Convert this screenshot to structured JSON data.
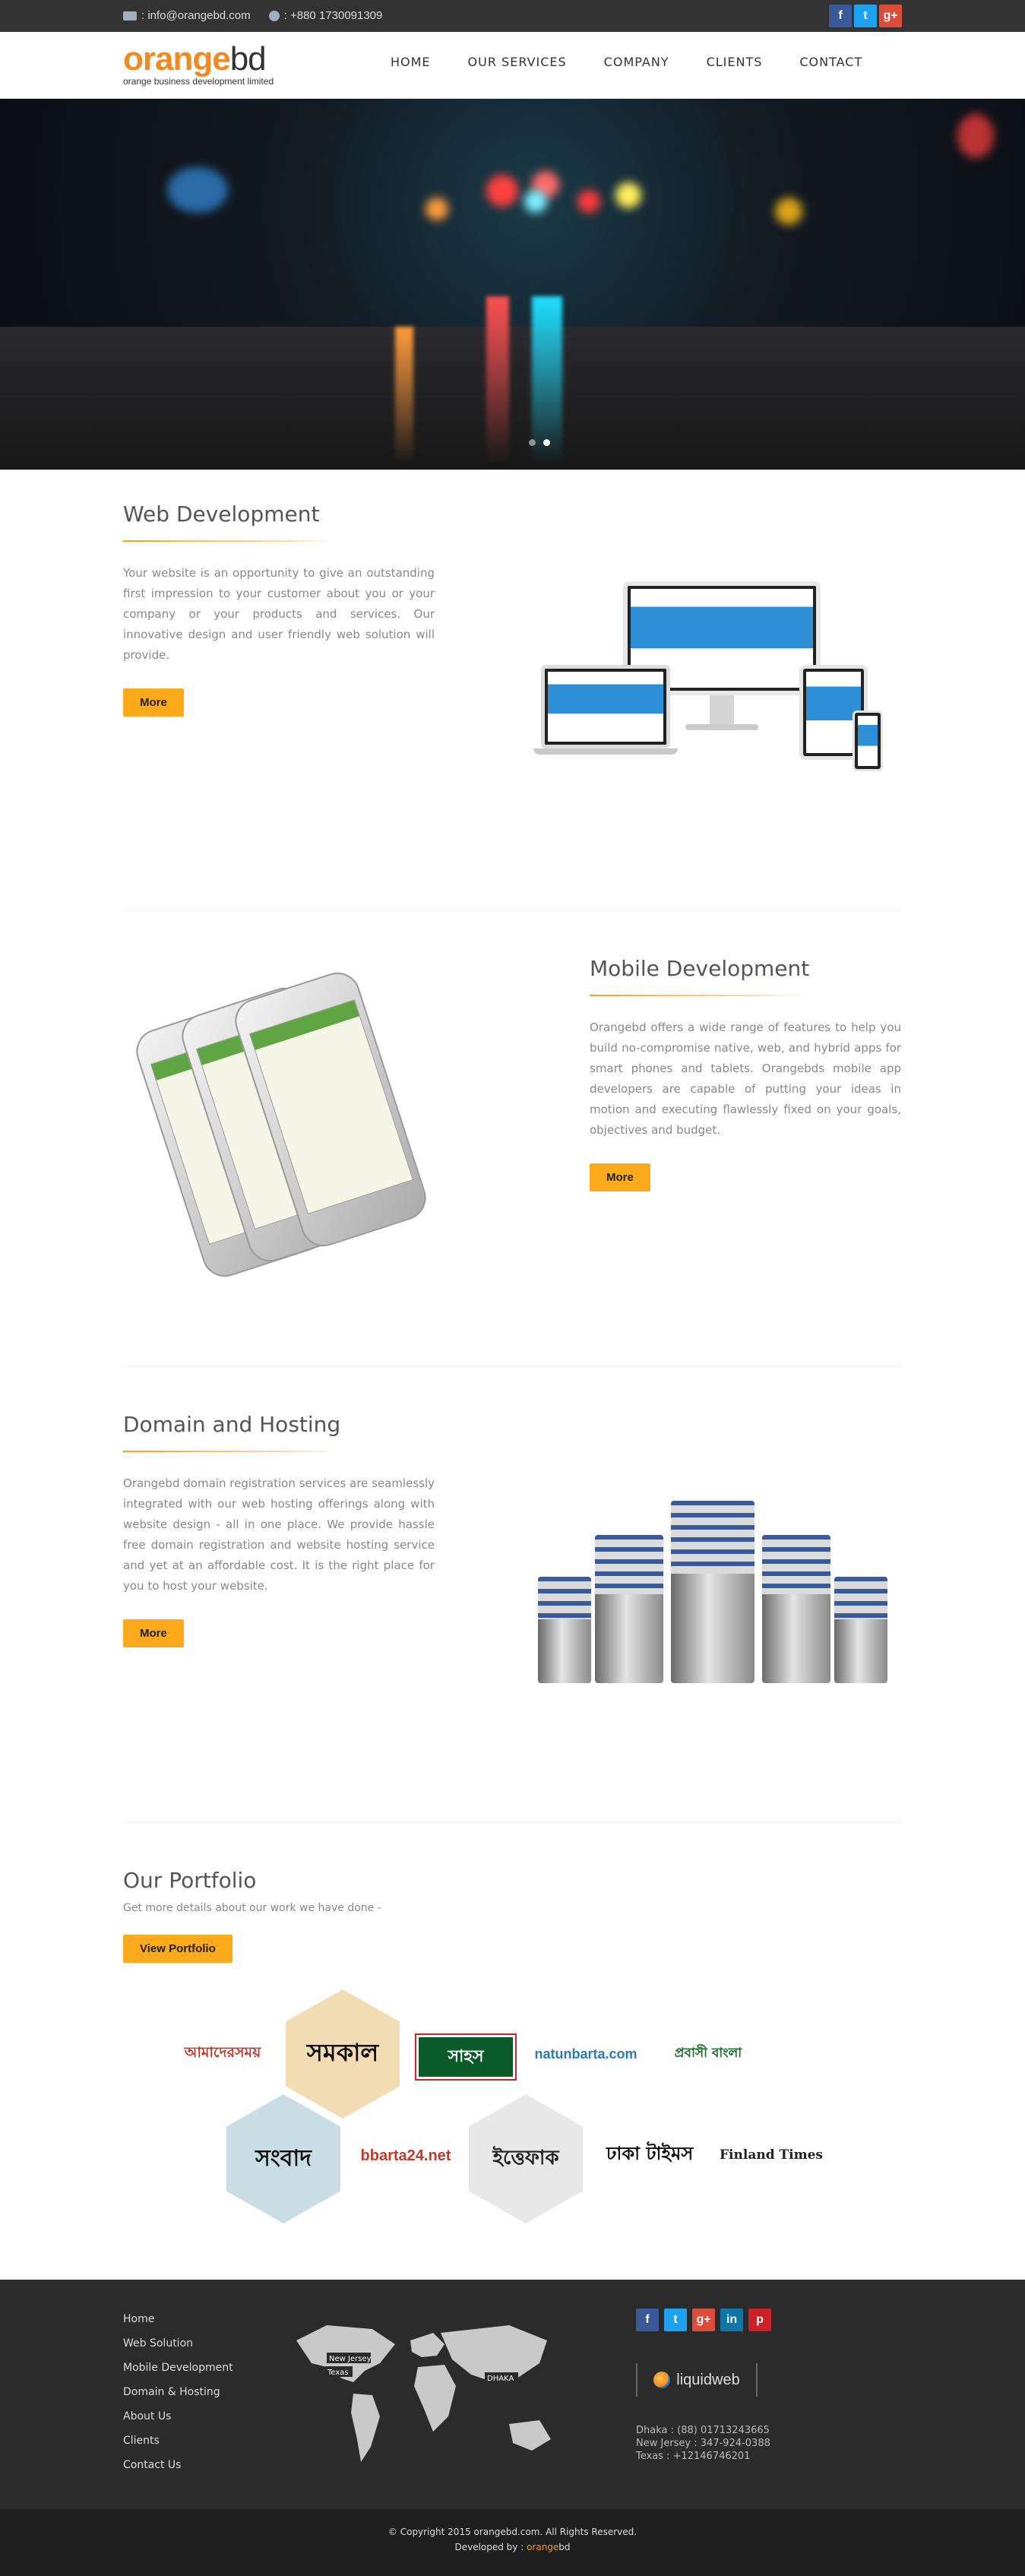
{
  "topbar": {
    "email": ": info@orangebd.com",
    "phone": ": +880 1730091309",
    "social": [
      "f",
      "t",
      "g+"
    ]
  },
  "header": {
    "logo_orange": "orange",
    "logo_bd": "bd",
    "logo_tagline": "orange business development limited",
    "nav": [
      "HOME",
      "OUR SERVICES",
      "COMPANY",
      "CLIENTS",
      "CONTACT"
    ]
  },
  "hero": {
    "slides": 2,
    "active_slide": 1
  },
  "services": [
    {
      "title": "Web Development",
      "text": "Your website is an opportunity to give an outstanding first impression to your customer about you or your company or your products and services. Our innovative design and user friendly web solution will provide.",
      "button": "More",
      "image": "responsive-devices-illustration"
    },
    {
      "title": "Mobile Development",
      "text": "Orangebd offers a wide range of features to help you build no-compromise native, web, and hybrid apps for smart phones and tablets. Orangebds mobile app developers are capable of putting your ideas in motion and executing flawlessly fixed on your goals, objectives and budget.",
      "button": "More",
      "image": "smartphones-illustration"
    },
    {
      "title": "Domain and Hosting",
      "text": "Orangebd domain registration services are seamlessly integrated with our web hosting offerings along with website design - all in one place. We provide hassle free domain registration and website hosting service and yet at an affordable cost. It is the right place for you to host your website.",
      "button": "More",
      "image": "servers-illustration"
    }
  ],
  "portfolio": {
    "title": "Our Portfolio",
    "subtitle": "Get more details about our work we have done -",
    "button": "View Portfolio",
    "clients_row1": [
      "আমাদেরসময়",
      "সমকাল",
      "সাহস",
      "natunbarta.com",
      "প্রবাসী বাংলা"
    ],
    "clients_row2": [
      "সংবাদ",
      "bbarta24.net",
      "ইত্তেফাক",
      "ঢাকা টাইমস",
      "Finland Times"
    ]
  },
  "footer": {
    "links": [
      "Home",
      "Web Solution",
      "Mobile Development",
      "Domain & Hosting",
      "About Us",
      "Clients",
      "Contact Us"
    ],
    "map_labels": [
      "New Jersey",
      "Texas",
      "DHAKA"
    ],
    "social": [
      "f",
      "t",
      "g+",
      "in",
      "p"
    ],
    "partner": "liquidweb",
    "offices": [
      "Dhaka : (88) 01713243665",
      "New Jersey : 347-924-0388",
      "Texas : +12146746201"
    ],
    "copyright": "© Copyright 2015 orangebd.com. All Rights Reserved.",
    "developed_by": "Developed by : ",
    "developer_orange": "orange",
    "developer_bd": "bd"
  }
}
